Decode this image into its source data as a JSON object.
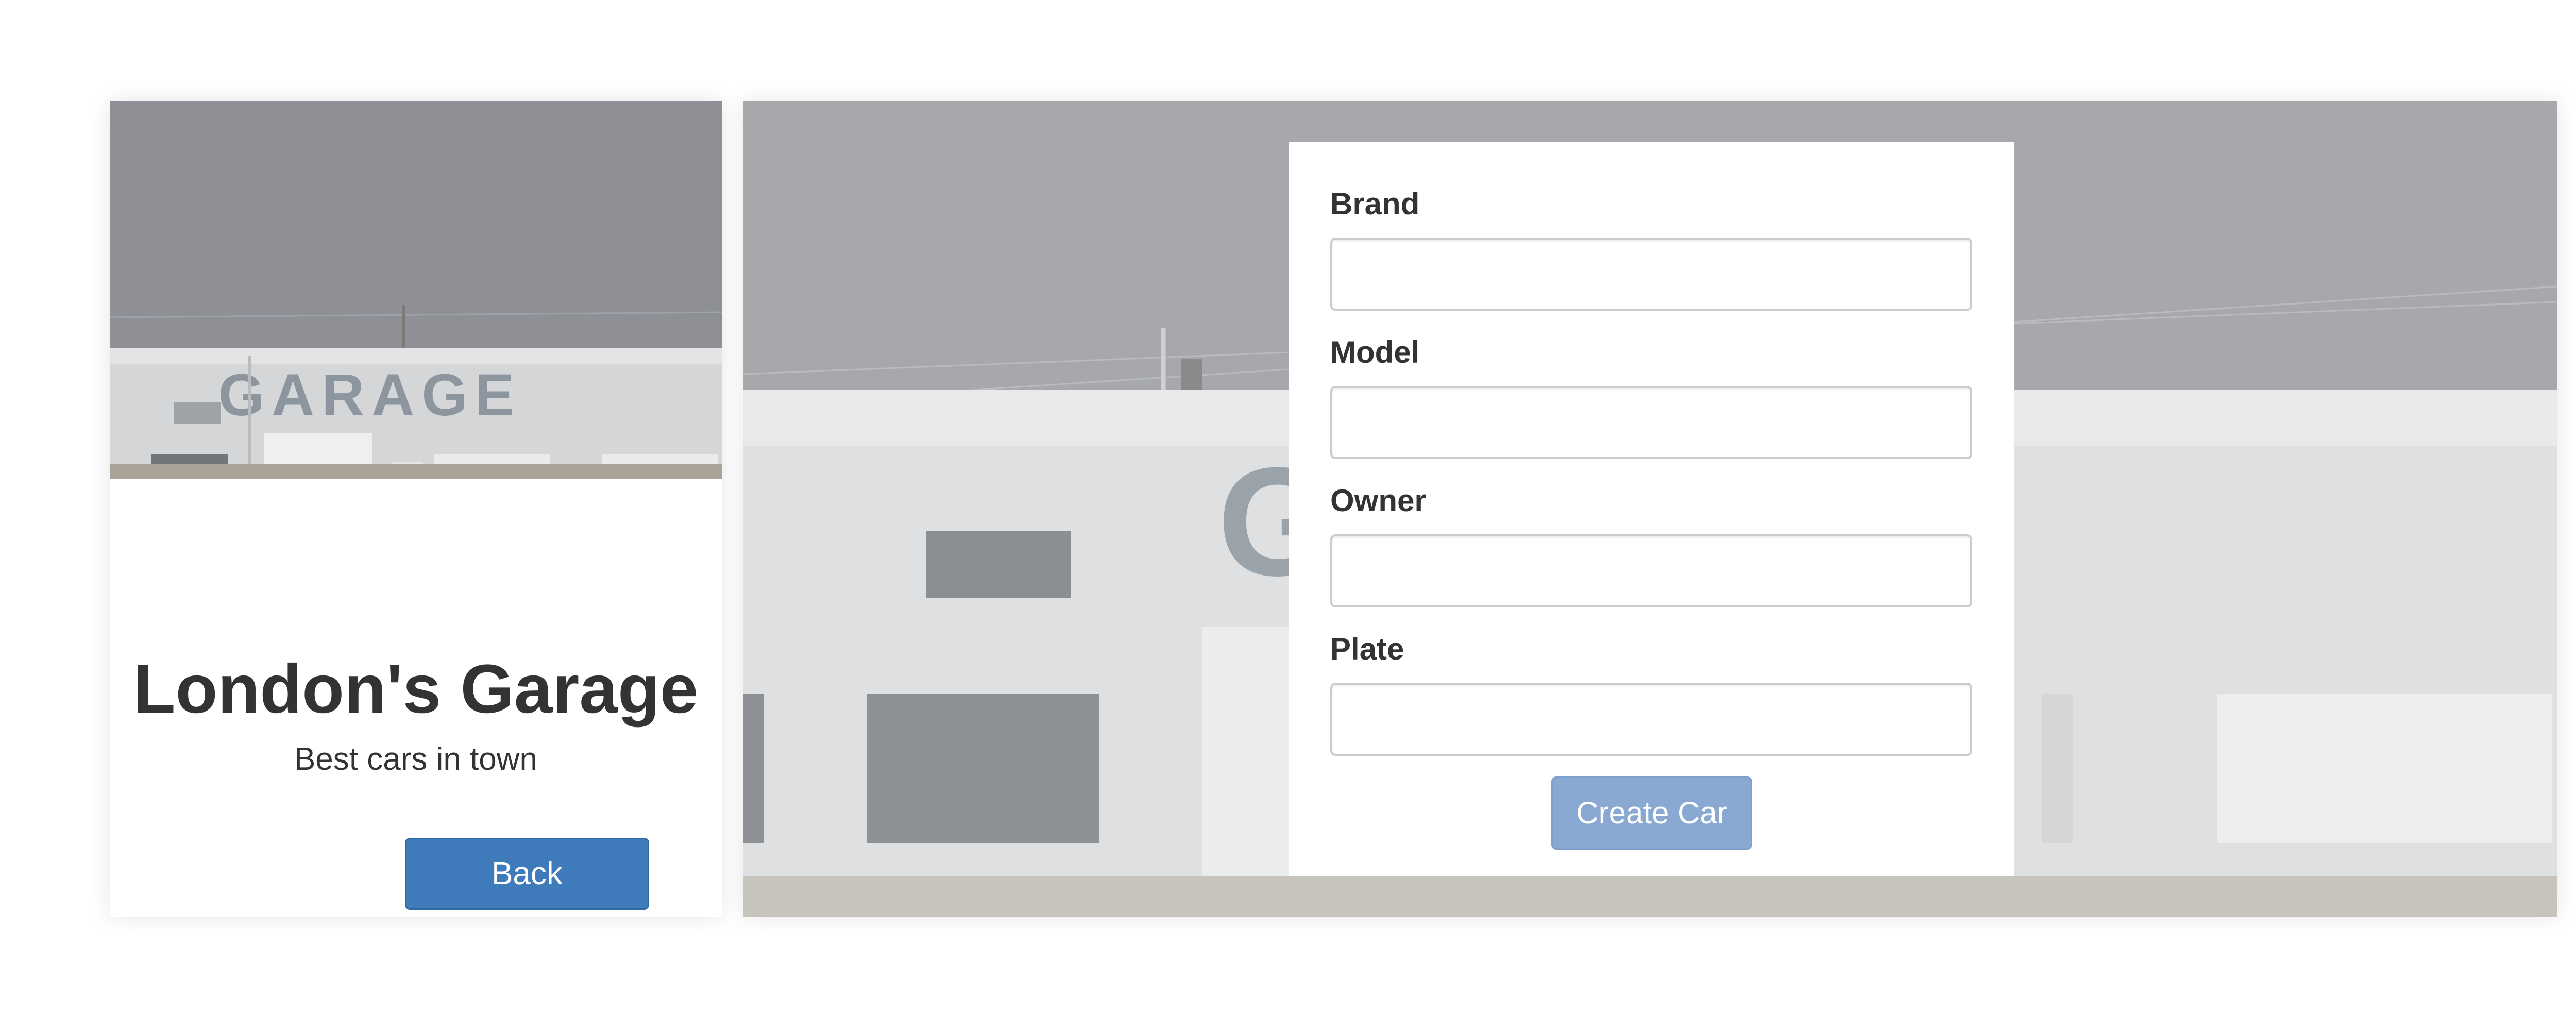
{
  "left_card": {
    "title": "London's Garage",
    "tagline": "Best cars in town",
    "back_label": "Back",
    "photo_sign": "GARAGE"
  },
  "form": {
    "fields": [
      {
        "label": "Brand",
        "value": "",
        "placeholder": ""
      },
      {
        "label": "Model",
        "value": "",
        "placeholder": ""
      },
      {
        "label": "Owner",
        "value": "",
        "placeholder": ""
      },
      {
        "label": "Plate",
        "value": "",
        "placeholder": ""
      }
    ],
    "submit_label": "Create Car"
  },
  "colors": {
    "primary_button": "#3f7bba",
    "disabled_button": "#89a9d3",
    "text": "#333333"
  }
}
